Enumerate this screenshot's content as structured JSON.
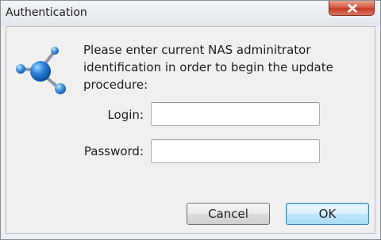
{
  "window": {
    "title": "Authentication",
    "close_icon": "close-icon"
  },
  "dialog": {
    "icon": "network-node-icon",
    "message": "Please enter current NAS adminitrator\nidentification in order to begin the update\nprocedure:",
    "login_label": "Login:",
    "login_value": "",
    "password_label": "Password:",
    "password_value": ""
  },
  "buttons": {
    "cancel_label": "Cancel",
    "ok_label": "OK"
  },
  "colors": {
    "dialog_background": "#f0f0f0",
    "close_button": "#c43c27",
    "default_button_border": "#3c7fb1",
    "icon_blue": "#1f6fc7"
  }
}
